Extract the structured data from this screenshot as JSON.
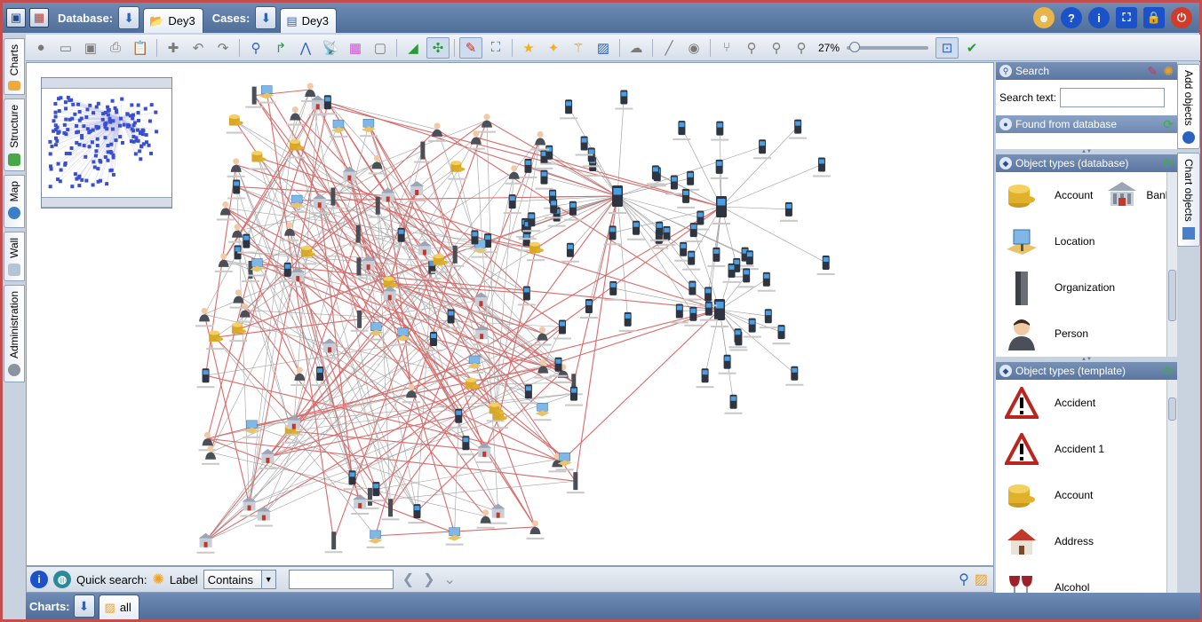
{
  "topbar": {
    "database_label": "Database:",
    "database_tab": "Dey3",
    "cases_label": "Cases:",
    "cases_tab": "Dey3"
  },
  "left_tabs": [
    "Charts",
    "Structure",
    "Map",
    "Wall",
    "Administration"
  ],
  "toolbar": {
    "zoom_percent": "27%",
    "zoom_level": 0.04
  },
  "quick_search": {
    "label": "Quick search:",
    "field_label": "Label",
    "mode": "Contains",
    "value": ""
  },
  "charts_bar": {
    "label": "Charts:",
    "tab": "all"
  },
  "right_panel": {
    "search_title": "Search",
    "search_text_label": "Search text:",
    "found_title": "Found from database",
    "types_db_title": "Object types (database)",
    "types_db": [
      {
        "label": "Account",
        "icon": "coins-icon"
      },
      {
        "label": "Bank",
        "icon": "bank-icon"
      },
      {
        "label": "Location",
        "icon": "location-icon"
      },
      {
        "label": "Organization",
        "icon": "building-icon"
      },
      {
        "label": "Person",
        "icon": "person-icon"
      }
    ],
    "types_tpl_title": "Object types (template)",
    "types_tpl": [
      {
        "label": "Accident",
        "icon": "warning-icon"
      },
      {
        "label": "Accident 1",
        "icon": "warning-icon"
      },
      {
        "label": "Account",
        "icon": "coins-icon"
      },
      {
        "label": "Address",
        "icon": "house-icon"
      },
      {
        "label": "Alcohol",
        "icon": "wine-icon"
      }
    ]
  },
  "right_tabs": [
    "Add objects",
    "Chart objects"
  ],
  "colors": {
    "accent": "#5a76a2",
    "link_red": "#d24b4b",
    "node_blue": "#3a4fd0"
  }
}
